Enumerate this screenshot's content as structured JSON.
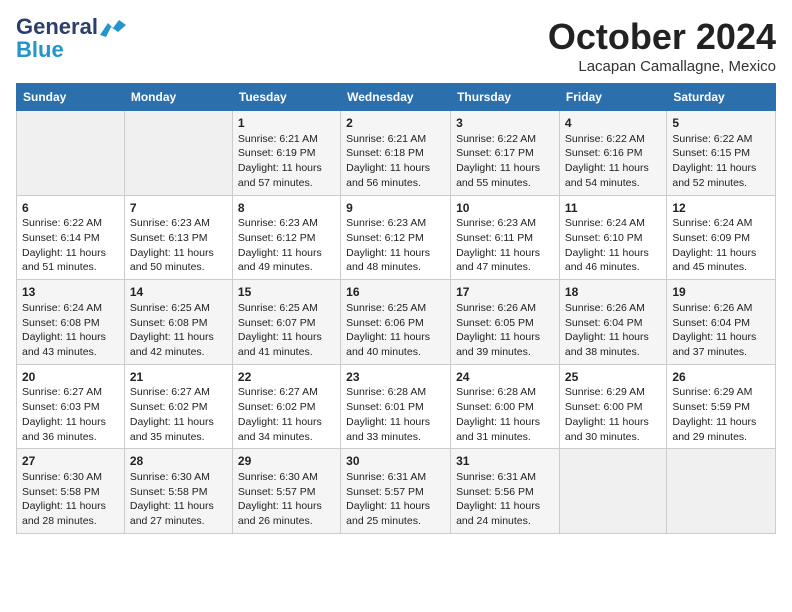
{
  "header": {
    "logo_general": "General",
    "logo_blue": "Blue",
    "month": "October 2024",
    "location": "Lacapan Camallagne, Mexico"
  },
  "days_of_week": [
    "Sunday",
    "Monday",
    "Tuesday",
    "Wednesday",
    "Thursday",
    "Friday",
    "Saturday"
  ],
  "weeks": [
    [
      {
        "day": "",
        "empty": true
      },
      {
        "day": "",
        "empty": true
      },
      {
        "day": "1",
        "sunrise": "Sunrise: 6:21 AM",
        "sunset": "Sunset: 6:19 PM",
        "daylight": "Daylight: 11 hours and 57 minutes."
      },
      {
        "day": "2",
        "sunrise": "Sunrise: 6:21 AM",
        "sunset": "Sunset: 6:18 PM",
        "daylight": "Daylight: 11 hours and 56 minutes."
      },
      {
        "day": "3",
        "sunrise": "Sunrise: 6:22 AM",
        "sunset": "Sunset: 6:17 PM",
        "daylight": "Daylight: 11 hours and 55 minutes."
      },
      {
        "day": "4",
        "sunrise": "Sunrise: 6:22 AM",
        "sunset": "Sunset: 6:16 PM",
        "daylight": "Daylight: 11 hours and 54 minutes."
      },
      {
        "day": "5",
        "sunrise": "Sunrise: 6:22 AM",
        "sunset": "Sunset: 6:15 PM",
        "daylight": "Daylight: 11 hours and 52 minutes."
      }
    ],
    [
      {
        "day": "6",
        "sunrise": "Sunrise: 6:22 AM",
        "sunset": "Sunset: 6:14 PM",
        "daylight": "Daylight: 11 hours and 51 minutes."
      },
      {
        "day": "7",
        "sunrise": "Sunrise: 6:23 AM",
        "sunset": "Sunset: 6:13 PM",
        "daylight": "Daylight: 11 hours and 50 minutes."
      },
      {
        "day": "8",
        "sunrise": "Sunrise: 6:23 AM",
        "sunset": "Sunset: 6:12 PM",
        "daylight": "Daylight: 11 hours and 49 minutes."
      },
      {
        "day": "9",
        "sunrise": "Sunrise: 6:23 AM",
        "sunset": "Sunset: 6:12 PM",
        "daylight": "Daylight: 11 hours and 48 minutes."
      },
      {
        "day": "10",
        "sunrise": "Sunrise: 6:23 AM",
        "sunset": "Sunset: 6:11 PM",
        "daylight": "Daylight: 11 hours and 47 minutes."
      },
      {
        "day": "11",
        "sunrise": "Sunrise: 6:24 AM",
        "sunset": "Sunset: 6:10 PM",
        "daylight": "Daylight: 11 hours and 46 minutes."
      },
      {
        "day": "12",
        "sunrise": "Sunrise: 6:24 AM",
        "sunset": "Sunset: 6:09 PM",
        "daylight": "Daylight: 11 hours and 45 minutes."
      }
    ],
    [
      {
        "day": "13",
        "sunrise": "Sunrise: 6:24 AM",
        "sunset": "Sunset: 6:08 PM",
        "daylight": "Daylight: 11 hours and 43 minutes."
      },
      {
        "day": "14",
        "sunrise": "Sunrise: 6:25 AM",
        "sunset": "Sunset: 6:08 PM",
        "daylight": "Daylight: 11 hours and 42 minutes."
      },
      {
        "day": "15",
        "sunrise": "Sunrise: 6:25 AM",
        "sunset": "Sunset: 6:07 PM",
        "daylight": "Daylight: 11 hours and 41 minutes."
      },
      {
        "day": "16",
        "sunrise": "Sunrise: 6:25 AM",
        "sunset": "Sunset: 6:06 PM",
        "daylight": "Daylight: 11 hours and 40 minutes."
      },
      {
        "day": "17",
        "sunrise": "Sunrise: 6:26 AM",
        "sunset": "Sunset: 6:05 PM",
        "daylight": "Daylight: 11 hours and 39 minutes."
      },
      {
        "day": "18",
        "sunrise": "Sunrise: 6:26 AM",
        "sunset": "Sunset: 6:04 PM",
        "daylight": "Daylight: 11 hours and 38 minutes."
      },
      {
        "day": "19",
        "sunrise": "Sunrise: 6:26 AM",
        "sunset": "Sunset: 6:04 PM",
        "daylight": "Daylight: 11 hours and 37 minutes."
      }
    ],
    [
      {
        "day": "20",
        "sunrise": "Sunrise: 6:27 AM",
        "sunset": "Sunset: 6:03 PM",
        "daylight": "Daylight: 11 hours and 36 minutes."
      },
      {
        "day": "21",
        "sunrise": "Sunrise: 6:27 AM",
        "sunset": "Sunset: 6:02 PM",
        "daylight": "Daylight: 11 hours and 35 minutes."
      },
      {
        "day": "22",
        "sunrise": "Sunrise: 6:27 AM",
        "sunset": "Sunset: 6:02 PM",
        "daylight": "Daylight: 11 hours and 34 minutes."
      },
      {
        "day": "23",
        "sunrise": "Sunrise: 6:28 AM",
        "sunset": "Sunset: 6:01 PM",
        "daylight": "Daylight: 11 hours and 33 minutes."
      },
      {
        "day": "24",
        "sunrise": "Sunrise: 6:28 AM",
        "sunset": "Sunset: 6:00 PM",
        "daylight": "Daylight: 11 hours and 31 minutes."
      },
      {
        "day": "25",
        "sunrise": "Sunrise: 6:29 AM",
        "sunset": "Sunset: 6:00 PM",
        "daylight": "Daylight: 11 hours and 30 minutes."
      },
      {
        "day": "26",
        "sunrise": "Sunrise: 6:29 AM",
        "sunset": "Sunset: 5:59 PM",
        "daylight": "Daylight: 11 hours and 29 minutes."
      }
    ],
    [
      {
        "day": "27",
        "sunrise": "Sunrise: 6:30 AM",
        "sunset": "Sunset: 5:58 PM",
        "daylight": "Daylight: 11 hours and 28 minutes."
      },
      {
        "day": "28",
        "sunrise": "Sunrise: 6:30 AM",
        "sunset": "Sunset: 5:58 PM",
        "daylight": "Daylight: 11 hours and 27 minutes."
      },
      {
        "day": "29",
        "sunrise": "Sunrise: 6:30 AM",
        "sunset": "Sunset: 5:57 PM",
        "daylight": "Daylight: 11 hours and 26 minutes."
      },
      {
        "day": "30",
        "sunrise": "Sunrise: 6:31 AM",
        "sunset": "Sunset: 5:57 PM",
        "daylight": "Daylight: 11 hours and 25 minutes."
      },
      {
        "day": "31",
        "sunrise": "Sunrise: 6:31 AM",
        "sunset": "Sunset: 5:56 PM",
        "daylight": "Daylight: 11 hours and 24 minutes."
      },
      {
        "day": "",
        "empty": true
      },
      {
        "day": "",
        "empty": true
      }
    ]
  ]
}
